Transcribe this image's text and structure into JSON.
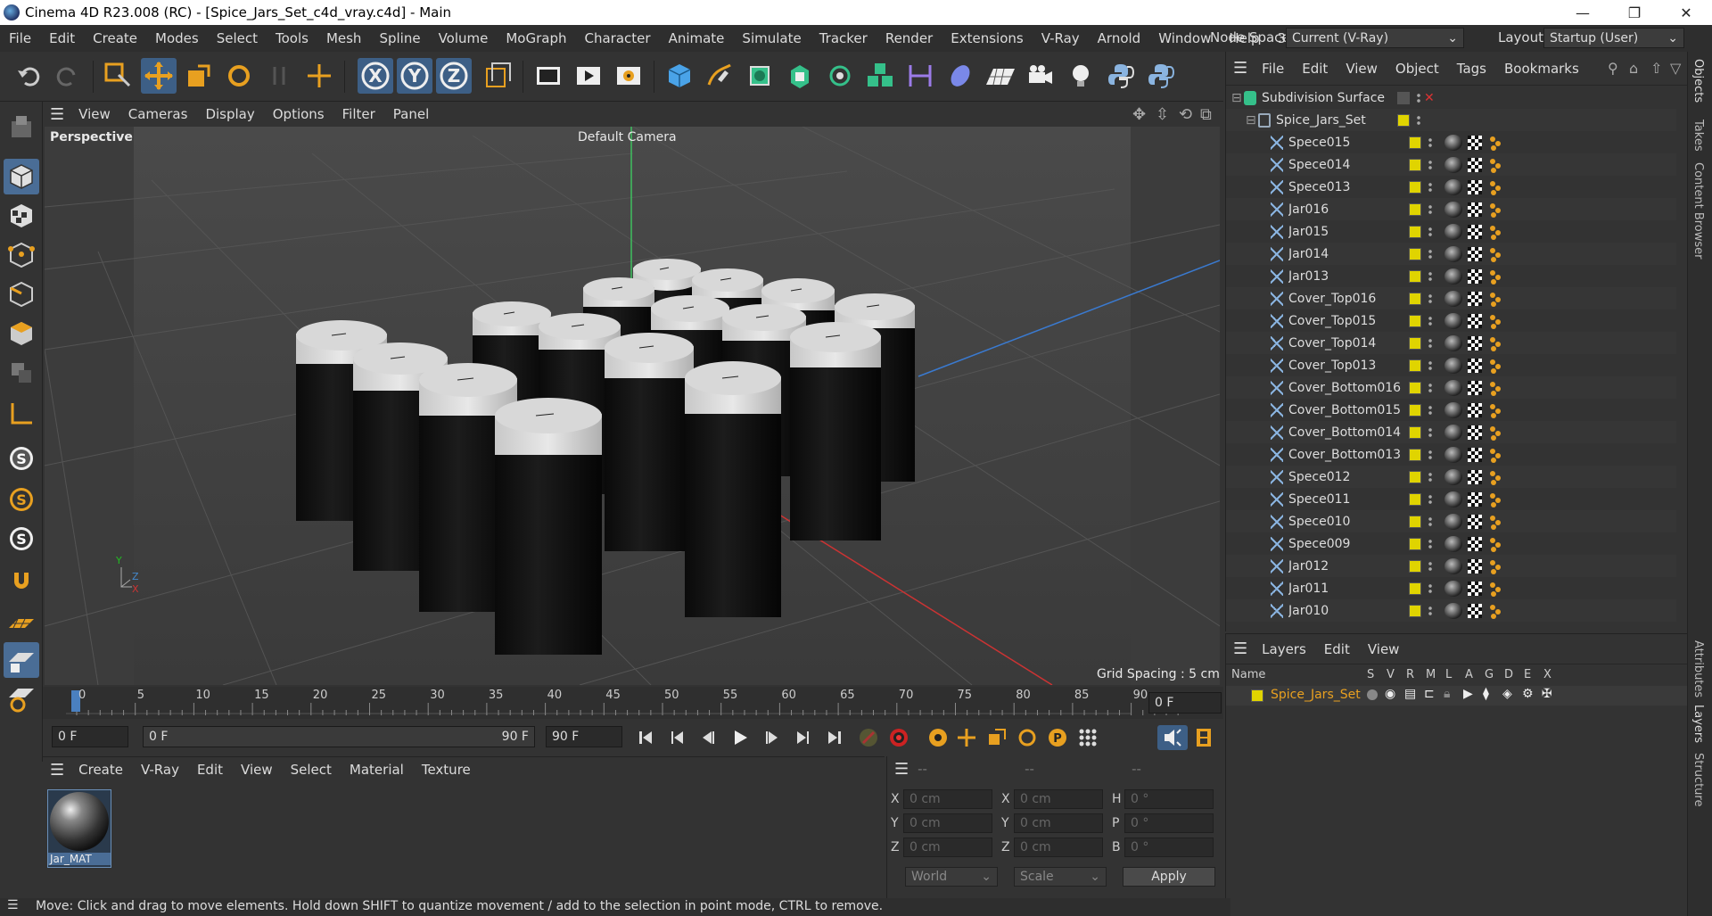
{
  "window": {
    "title": "Cinema 4D R23.008 (RC) - [Spice_Jars_Set_c4d_vray.c4d] - Main",
    "min": "—",
    "max": "❐",
    "close": "✕"
  },
  "menubar": [
    "File",
    "Edit",
    "Create",
    "Modes",
    "Select",
    "Tools",
    "Mesh",
    "Spline",
    "Volume",
    "MoGraph",
    "Character",
    "Animate",
    "Simulate",
    "Tracker",
    "Render",
    "Extensions",
    "V-Ray",
    "Arnold",
    "Window",
    "Help",
    "3DToAll"
  ],
  "nodespace": {
    "label": "Node Space:",
    "value": "Current (V-Ray)"
  },
  "layout": {
    "label": "Layout:",
    "value": "Startup (User)"
  },
  "viewport": {
    "menu": [
      "View",
      "Cameras",
      "Display",
      "Options",
      "Filter",
      "Panel"
    ],
    "name": "Perspective",
    "camera": "Default Camera",
    "grid_spacing": "Grid Spacing : 5 cm",
    "axis_y": "Y",
    "axis_z": "Z",
    "axis_x": "X"
  },
  "timeline": {
    "ticks": [
      "0",
      "5",
      "10",
      "15",
      "20",
      "25",
      "30",
      "35",
      "40",
      "45",
      "50",
      "55",
      "60",
      "65",
      "70",
      "75",
      "80",
      "85",
      "90"
    ],
    "current_frame": "0 F"
  },
  "playback": {
    "start": "0 F",
    "range_start": "0 F",
    "range_end": "90 F",
    "end": "90 F"
  },
  "materials": {
    "menu": [
      "Create",
      "V-Ray",
      "Edit",
      "View",
      "Select",
      "Material",
      "Texture"
    ],
    "items": [
      {
        "name": "Jar_MAT"
      }
    ]
  },
  "coords": {
    "headers": [
      "--",
      "--",
      "--"
    ],
    "rows": [
      {
        "l1": "X",
        "v1": "0 cm",
        "l2": "X",
        "v2": "0 cm",
        "l3": "H",
        "v3": "0 °"
      },
      {
        "l1": "Y",
        "v1": "0 cm",
        "l2": "Y",
        "v2": "0 cm",
        "l3": "P",
        "v3": "0 °"
      },
      {
        "l1": "Z",
        "v1": "0 cm",
        "l2": "Z",
        "v2": "0 cm",
        "l3": "B",
        "v3": "0 °"
      }
    ],
    "mode1": "World",
    "mode2": "Scale",
    "apply": "Apply"
  },
  "objects": {
    "menu": [
      "File",
      "Edit",
      "View",
      "Object",
      "Tags",
      "Bookmarks"
    ],
    "root": "Subdivision Surface",
    "group": "Spice_Jars_Set",
    "items": [
      "Spece015",
      "Spece014",
      "Spece013",
      "Jar016",
      "Jar015",
      "Jar014",
      "Jar013",
      "Cover_Top016",
      "Cover_Top015",
      "Cover_Top014",
      "Cover_Top013",
      "Cover_Bottom016",
      "Cover_Bottom015",
      "Cover_Bottom014",
      "Cover_Bottom013",
      "Spece012",
      "Spece011",
      "Spece010",
      "Spece009",
      "Jar012",
      "Jar011",
      "Jar010"
    ]
  },
  "layers": {
    "menu": [
      "Layers",
      "Edit",
      "View"
    ],
    "columns": [
      "Name",
      "S",
      "V",
      "R",
      "M",
      "L",
      "A",
      "G",
      "D",
      "E",
      "X"
    ],
    "items": [
      {
        "name": "Spice_Jars_Set",
        "color": "#e0d400"
      }
    ]
  },
  "side_tabs": [
    "Objects",
    "Takes",
    "Content Browser",
    "Attributes",
    "Layers",
    "Structure"
  ],
  "status": "Move: Click and drag to move elements. Hold down SHIFT to quantize movement / add to the selection in point mode, CTRL to remove."
}
